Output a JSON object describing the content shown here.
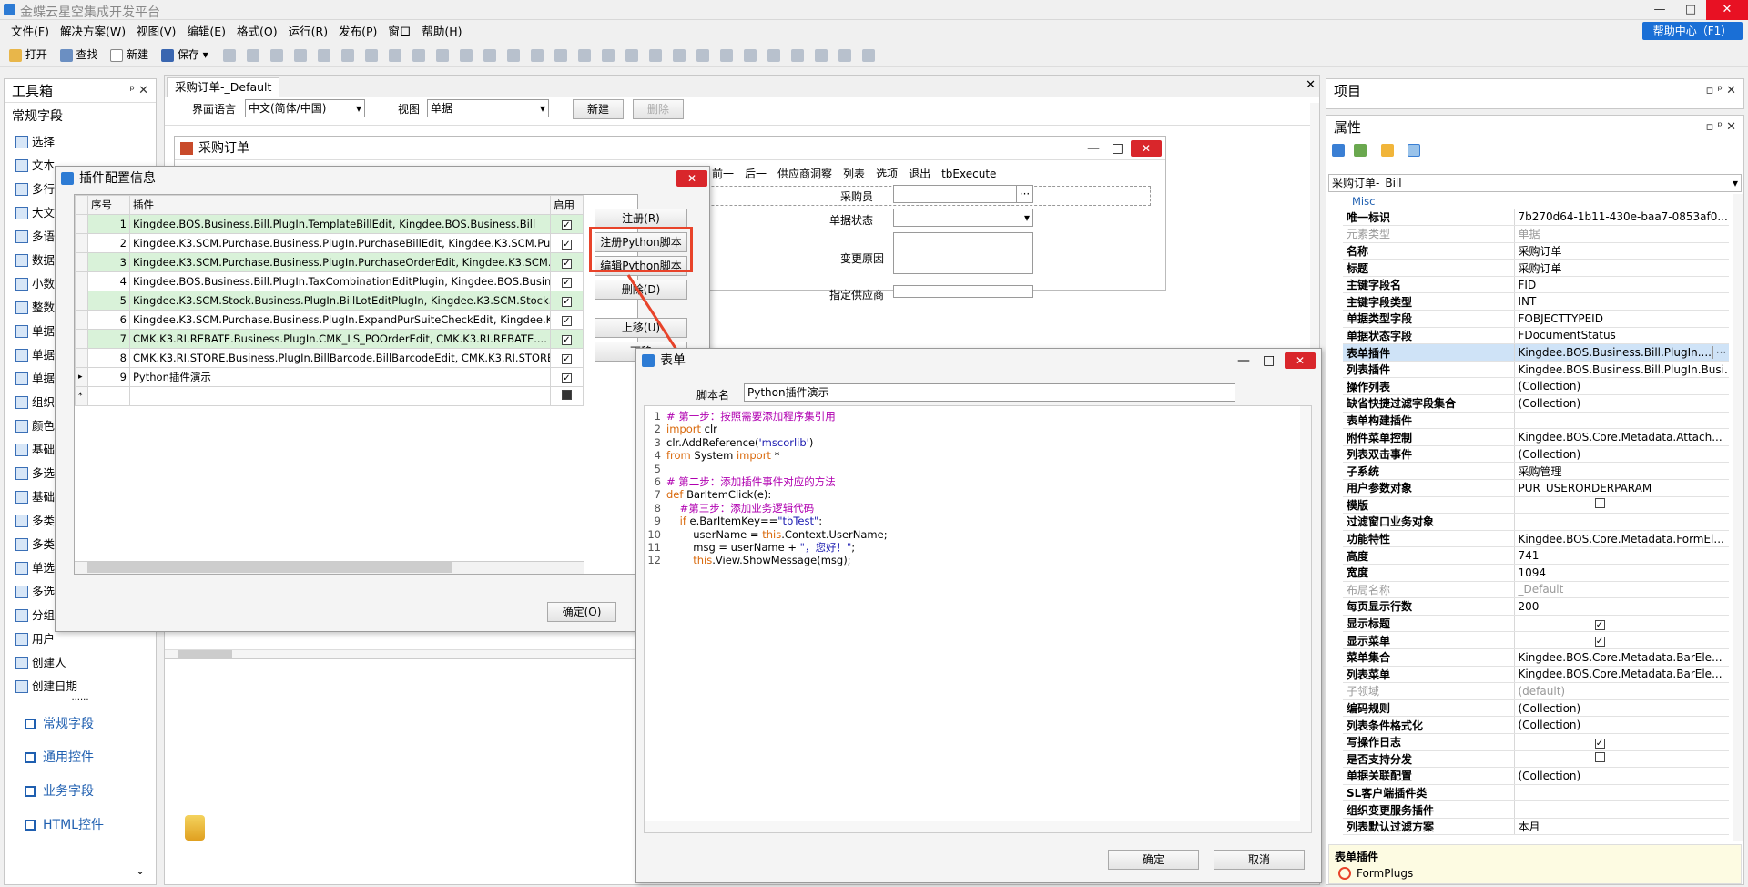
{
  "window": {
    "title": "金蝶云星空集成开发平台",
    "close": "✕",
    "max": "□",
    "min": "—"
  },
  "menu": [
    "文件(F)",
    "解决方案(W)",
    "视图(V)",
    "编辑(E)",
    "格式(O)",
    "运行(R)",
    "发布(P)",
    "窗口",
    "帮助(H)"
  ],
  "help_center": "帮助中心（F1）",
  "toolbar": {
    "open": "打开",
    "find": "查找",
    "new": "新建",
    "save": "保存"
  },
  "toolbox": {
    "title": "工具箱",
    "section": "常规字段",
    "items": [
      "选择",
      "文本",
      "多行",
      "大文",
      "多语",
      "数据",
      "小数",
      "整数",
      "单据",
      "单据",
      "单据",
      "组织",
      "颜色",
      "基础",
      "多选",
      "基础",
      "多类",
      "多类",
      "单选",
      "多选",
      "分组",
      "用户",
      "创建人",
      "创建日期"
    ],
    "categories": [
      "常规字段",
      "通用控件",
      "业务字段",
      "HTML控件"
    ]
  },
  "doc_tab": "采购订单-_Default",
  "view_bar": {
    "lang_label": "界面语言",
    "lang_value": "中文(简体/中国)",
    "view_label": "视图",
    "view_value": "单据",
    "new": "新建",
    "delete": "删除"
  },
  "form": {
    "title": "采购订单",
    "toolbar": [
      "前一",
      "后一",
      "供应商洞察",
      "列表",
      "选项",
      "退出",
      "tbExecute"
    ],
    "labels": [
      "采购员",
      "单据状态",
      "变更原因",
      "指定供应商"
    ]
  },
  "plugin_dialog": {
    "title": "插件配置信息",
    "columns": [
      "序号",
      "插件",
      "启用"
    ],
    "rows": [
      {
        "no": "1",
        "plugin": "Kingdee.BOS.Business.Bill.PlugIn.TemplateBillEdit, Kingdee.BOS.Business.Bill",
        "green": true
      },
      {
        "no": "2",
        "plugin": "Kingdee.K3.SCM.Purchase.Business.PlugIn.PurchaseBillEdit, Kingdee.K3.SCM.Purc...",
        "green": false
      },
      {
        "no": "3",
        "plugin": "Kingdee.K3.SCM.Purchase.Business.PlugIn.PurchaseOrderEdit, Kingdee.K3.SCM....",
        "green": true
      },
      {
        "no": "4",
        "plugin": " Kingdee.BOS.Business.Bill.PlugIn.TaxCombinationEditPlugin, Kingdee.BOS.Busine...",
        "green": false
      },
      {
        "no": "5",
        "plugin": "Kingdee.K3.SCM.Stock.Business.PlugIn.BillLotEditPlugIn, Kingdee.K3.SCM.Stock....",
        "green": true
      },
      {
        "no": "6",
        "plugin": "Kingdee.K3.SCM.Purchase.Business.PlugIn.ExpandPurSuiteCheckEdit, Kingdee.K...",
        "green": false
      },
      {
        "no": "7",
        "plugin": "CMK.K3.RI.REBATE.Business.PlugIn.CMK_LS_POOrderEdit, CMK.K3.RI.REBATE....",
        "green": true
      },
      {
        "no": "8",
        "plugin": "CMK.K3.RI.STORE.Business.PlugIn.BillBarcode.BillBarcodeEdit, CMK.K3.RI.STORE....",
        "green": false
      },
      {
        "no": "9",
        "plugin": "Python插件演示",
        "green": false
      }
    ],
    "buttons": {
      "register": "注册(R)",
      "register_py": "注册Python脚本",
      "edit_py": "编辑Python脚本",
      "delete": "删除(D)",
      "up": "上移(U)",
      "down": "下移",
      "ok": "确定(O)"
    }
  },
  "script_dialog": {
    "title": "表单",
    "name_label": "脚本名",
    "name_value": "Python插件演示",
    "ok": "确定",
    "cancel": "取消",
    "lines": [
      [
        [
          "cm",
          "# 第一步：按照需要添加程序集引用"
        ]
      ],
      [
        [
          "kw",
          "import"
        ],
        [
          "tx",
          " clr"
        ]
      ],
      [
        [
          "tx",
          "clr.AddReference("
        ],
        [
          "st",
          "'mscorlib'"
        ],
        [
          "tx",
          ")"
        ]
      ],
      [
        [
          "kw",
          "from"
        ],
        [
          "tx",
          " System "
        ],
        [
          "kw",
          "import"
        ],
        [
          "tx",
          " *"
        ]
      ],
      [
        [
          "tx",
          ""
        ]
      ],
      [
        [
          "cm",
          "# 第二步：添加插件事件对应的方法"
        ]
      ],
      [
        [
          "kw",
          "def"
        ],
        [
          "tx",
          " BarItemClick(e):"
        ]
      ],
      [
        [
          "cm",
          "    #第三步：添加业务逻辑代码"
        ]
      ],
      [
        [
          "kw",
          "    if"
        ],
        [
          "tx",
          " e.BarItemKey=="
        ],
        [
          "st",
          "\"tbTest\""
        ],
        [
          "tx",
          ":"
        ]
      ],
      [
        [
          "tx",
          "        userName = "
        ],
        [
          "kw",
          "this"
        ],
        [
          "tx",
          ".Context.UserName;"
        ]
      ],
      [
        [
          "tx",
          "        msg = userName + "
        ],
        [
          "st",
          "\"，您好！\""
        ],
        [
          "tx",
          ";"
        ]
      ],
      [
        [
          "kw",
          "        this"
        ],
        [
          "tx",
          ".View.ShowMessage(msg);"
        ]
      ]
    ]
  },
  "project_panel": {
    "title": "项目"
  },
  "properties": {
    "title": "属性",
    "object": "采购订单-_Bill",
    "group": "Misc",
    "rows": [
      {
        "k": "唯一标识",
        "v": "7b270d64-1b11-430e-baa7-0853af0..."
      },
      {
        "k": "元素类型",
        "v": "单据",
        "gray": true
      },
      {
        "k": "名称",
        "v": "采购订单"
      },
      {
        "k": "标题",
        "v": "采购订单"
      },
      {
        "k": "主键字段名",
        "v": "FID"
      },
      {
        "k": "主键字段类型",
        "v": "INT"
      },
      {
        "k": "单据类型字段",
        "v": "FOBJECTTYPEID"
      },
      {
        "k": "单据状态字段",
        "v": "FDocumentStatus"
      },
      {
        "k": "表单插件",
        "v": "Kingdee.BOS.Business.Bill.PlugIn....",
        "sel": true
      },
      {
        "k": "列表插件",
        "v": "Kingdee.BOS.Business.Bill.PlugIn.Busi..."
      },
      {
        "k": "操作列表",
        "v": "(Collection)"
      },
      {
        "k": "缺省快捷过滤字段集合",
        "v": "(Collection)"
      },
      {
        "k": "表单构建插件",
        "v": ""
      },
      {
        "k": "附件菜单控制",
        "v": "Kingdee.BOS.Core.Metadata.Attach..."
      },
      {
        "k": "列表双击事件",
        "v": "(Collection)"
      },
      {
        "k": "子系统",
        "v": "采购管理"
      },
      {
        "k": "用户参数对象",
        "v": "PUR_USERORDERPARAM"
      },
      {
        "k": "模版",
        "v": "",
        "cb": false
      },
      {
        "k": "过滤窗口业务对象",
        "v": ""
      },
      {
        "k": "功能特性",
        "v": "Kingdee.BOS.Core.Metadata.FormEl..."
      },
      {
        "k": "高度",
        "v": "741"
      },
      {
        "k": "宽度",
        "v": "1094"
      },
      {
        "k": "布局名称",
        "v": "_Default",
        "gray": true
      },
      {
        "k": "每页显示行数",
        "v": "200"
      },
      {
        "k": "显示标题",
        "v": "",
        "cb": true
      },
      {
        "k": "显示菜单",
        "v": "",
        "cb": true
      },
      {
        "k": "菜单集合",
        "v": "Kingdee.BOS.Core.Metadata.BarEle..."
      },
      {
        "k": "列表菜单",
        "v": "Kingdee.BOS.Core.Metadata.BarEle..."
      },
      {
        "k": "子领域",
        "v": "(default)",
        "gray": true
      },
      {
        "k": "编码规则",
        "v": "(Collection)"
      },
      {
        "k": "列表条件格式化",
        "v": "(Collection)"
      },
      {
        "k": "写操作日志",
        "v": "",
        "cb": true
      },
      {
        "k": "是否支持分发",
        "v": "",
        "cb": false
      },
      {
        "k": "单据关联配置",
        "v": "(Collection)"
      },
      {
        "k": "SL客户端插件类",
        "v": ""
      },
      {
        "k": "组织变更服务插件",
        "v": ""
      },
      {
        "k": "列表默认过滤方案",
        "v": "本月"
      }
    ],
    "desc_title": "表单插件",
    "desc_value": "FormPlugs"
  },
  "colors": {
    "accent": "#1a6fd6",
    "highlight": "#e8432a",
    "grid_green": "#d9f2d9"
  }
}
